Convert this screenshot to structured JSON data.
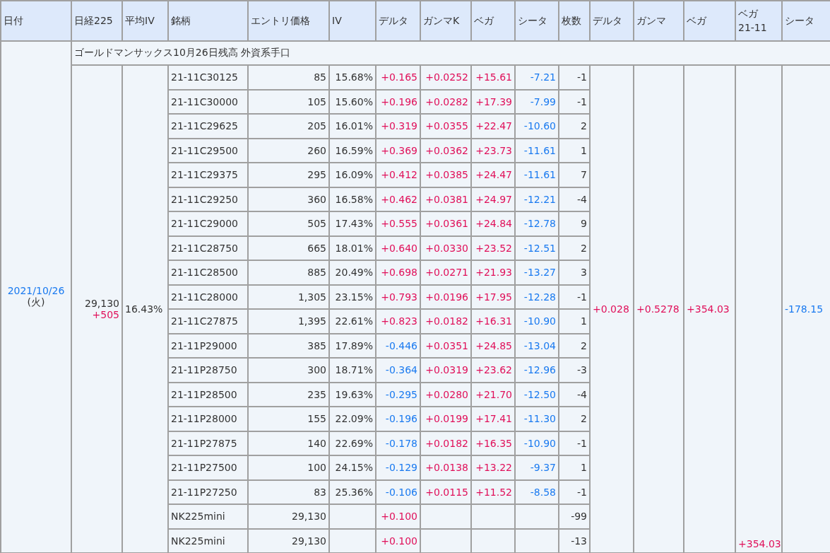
{
  "columns": [
    "日付",
    "日経225",
    "平均IV",
    "銘柄",
    "エントリ価格",
    "IV",
    "デルタ",
    "ガンマK",
    "ベガ",
    "シータ",
    "枚数",
    "デルタ",
    "ガンマ",
    "ベガ",
    "ベガ\n21-11",
    "シータ"
  ],
  "date": "2021/10/26",
  "weekday": "(火)",
  "nikkei": "29,130",
  "nikkei_change": "+505",
  "avg_iv": "16.43%",
  "subtitle": "ゴールドマンサックス10月26日残高 外資系手口",
  "rows": [
    {
      "name": "21-11C30125",
      "price": "85",
      "iv": "15.68%",
      "delta": "+0.165",
      "color": "#e0105a",
      "gamma": "+0.0252",
      "vega": "+15.61",
      "theta": "-7.21",
      "qty": "-1"
    },
    {
      "name": "21-11C30000",
      "price": "105",
      "iv": "15.60%",
      "delta": "+0.196",
      "color": "#e0105a",
      "gamma": "+0.0282",
      "vega": "+17.39",
      "theta": "-7.99",
      "qty": "-1"
    },
    {
      "name": "21-11C29625",
      "price": "205",
      "iv": "16.01%",
      "delta": "+0.319",
      "color": "#e0105a",
      "gamma": "+0.0355",
      "vega": "+22.47",
      "theta": "-10.60",
      "qty": "2"
    },
    {
      "name": "21-11C29500",
      "price": "260",
      "iv": "16.59%",
      "delta": "+0.369",
      "color": "#e0105a",
      "gamma": "+0.0362",
      "vega": "+23.73",
      "theta": "-11.61",
      "qty": "1"
    },
    {
      "name": "21-11C29375",
      "price": "295",
      "iv": "16.09%",
      "delta": "+0.412",
      "color": "#e0105a",
      "gamma": "+0.0385",
      "vega": "+24.47",
      "theta": "-11.61",
      "qty": "7"
    },
    {
      "name": "21-11C29250",
      "price": "360",
      "iv": "16.58%",
      "delta": "+0.462",
      "color": "#e0105a",
      "gamma": "+0.0381",
      "vega": "+24.97",
      "theta": "-12.21",
      "qty": "-4"
    },
    {
      "name": "21-11C29000",
      "price": "505",
      "iv": "17.43%",
      "delta": "+0.555",
      "color": "#e0105a",
      "gamma": "+0.0361",
      "vega": "+24.84",
      "theta": "-12.78",
      "qty": "9"
    },
    {
      "name": "21-11C28750",
      "price": "665",
      "iv": "18.01%",
      "delta": "+0.640",
      "color": "#e0105a",
      "gamma": "+0.0330",
      "vega": "+23.52",
      "theta": "-12.51",
      "qty": "2"
    },
    {
      "name": "21-11C28500",
      "price": "885",
      "iv": "20.49%",
      "delta": "+0.698",
      "color": "#e0105a",
      "gamma": "+0.0271",
      "vega": "+21.93",
      "theta": "-13.27",
      "qty": "3"
    },
    {
      "name": "21-11C28000",
      "price": "1,305",
      "iv": "23.15%",
      "delta": "+0.793",
      "color": "#e0105a",
      "gamma": "+0.0196",
      "vega": "+17.95",
      "theta": "-12.28",
      "qty": "-1"
    },
    {
      "name": "21-11C27875",
      "price": "1,395",
      "iv": "22.61%",
      "delta": "+0.823",
      "color": "#e0105a",
      "gamma": "+0.0182",
      "vega": "+16.31",
      "theta": "-10.90",
      "qty": "1"
    },
    {
      "name": "21-11P29000",
      "price": "385",
      "iv": "17.89%",
      "delta": "-0.446",
      "color": "#1a7af0",
      "gamma": "+0.0351",
      "vega": "+24.85",
      "theta": "-13.04",
      "qty": "2"
    },
    {
      "name": "21-11P28750",
      "price": "300",
      "iv": "18.71%",
      "delta": "-0.364",
      "color": "#1a7af0",
      "gamma": "+0.0319",
      "vega": "+23.62",
      "theta": "-12.96",
      "qty": "-3"
    },
    {
      "name": "21-11P28500",
      "price": "235",
      "iv": "19.63%",
      "delta": "-0.295",
      "color": "#1a7af0",
      "gamma": "+0.0280",
      "vega": "+21.70",
      "theta": "-12.50",
      "qty": "-4"
    },
    {
      "name": "21-11P28000",
      "price": "155",
      "iv": "22.09%",
      "delta": "-0.196",
      "color": "#1a7af0",
      "gamma": "+0.0199",
      "vega": "+17.41",
      "theta": "-11.30",
      "qty": "2"
    },
    {
      "name": "21-11P27875",
      "price": "140",
      "iv": "22.69%",
      "delta": "-0.178",
      "color": "#1a7af0",
      "gamma": "+0.0182",
      "vega": "+16.35",
      "theta": "-10.90",
      "qty": "-1"
    },
    {
      "name": "21-11P27500",
      "price": "100",
      "iv": "24.15%",
      "delta": "-0.129",
      "color": "#1a7af0",
      "gamma": "+0.0138",
      "vega": "+13.22",
      "theta": "-9.37",
      "qty": "1"
    },
    {
      "name": "21-11P27250",
      "price": "83",
      "iv": "25.36%",
      "delta": "-0.106",
      "color": "#1a7af0",
      "gamma": "+0.0115",
      "vega": "+11.52",
      "theta": "-8.58",
      "qty": "-1"
    },
    {
      "name": "NK225mini",
      "price": "29,130",
      "delta": "+0.100",
      "color": "#e0105a",
      "qty": "-99"
    },
    {
      "name": "NK225mini",
      "price": "29,130",
      "delta": "+0.100",
      "color": "#e0105a",
      "qty": "-13"
    }
  ],
  "total_delta": "+0.028",
  "total_gamma": "+0.5278",
  "total_vega": "+354.03",
  "vega_21_11": "+354.03",
  "total_theta": "-178.15"
}
